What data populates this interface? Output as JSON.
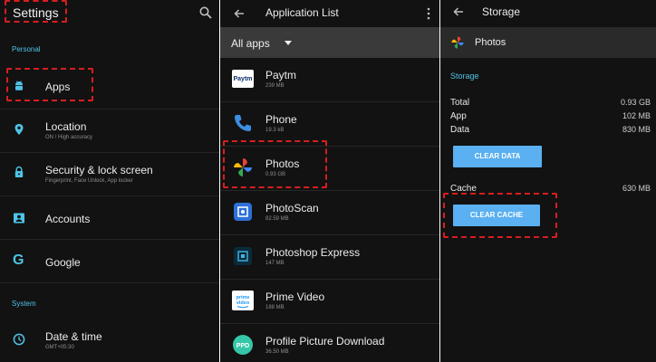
{
  "settings": {
    "title": "Settings",
    "search_icon": "search-icon",
    "section_personal": "Personal",
    "section_system": "System",
    "items": [
      {
        "label": "Apps",
        "sub": "",
        "icon": "android-icon"
      },
      {
        "label": "Location",
        "sub": "ON / High accuracy",
        "icon": "location-pin-icon"
      },
      {
        "label": "Security & lock screen",
        "sub": "Fingerprint, Face Unlock, App locker",
        "icon": "lock-icon"
      },
      {
        "label": "Accounts",
        "sub": "",
        "icon": "account-card-icon"
      },
      {
        "label": "Google",
        "sub": "",
        "icon": "google-g-icon"
      },
      {
        "label": "Date & time",
        "sub": "GMT+05:30",
        "icon": "clock-icon"
      }
    ]
  },
  "app_list": {
    "title": "Application List",
    "filter": "All apps",
    "apps": [
      {
        "name": "Paytm",
        "size": "239 MB",
        "icon": "paytm-icon"
      },
      {
        "name": "Phone",
        "size": "19.3 kB",
        "icon": "phone-icon"
      },
      {
        "name": "Photos",
        "size": "0.93 GB",
        "icon": "google-photos-icon"
      },
      {
        "name": "PhotoScan",
        "size": "82.59 MB",
        "icon": "photoscan-icon"
      },
      {
        "name": "Photoshop Express",
        "size": "147 MB",
        "icon": "photoshop-express-icon"
      },
      {
        "name": "Prime Video",
        "size": "188 MB",
        "icon": "prime-video-icon"
      },
      {
        "name": "Profile Picture Download",
        "size": "36.50 MB",
        "icon": "profile-picture-icon"
      }
    ]
  },
  "storage": {
    "title": "Storage",
    "app_name": "Photos",
    "section": "Storage",
    "stats": [
      {
        "label": "Total",
        "value": "0.93 GB"
      },
      {
        "label": "App",
        "value": "102 MB"
      },
      {
        "label": "Data",
        "value": "830 MB"
      }
    ],
    "clear_data_label": "CLEAR DATA",
    "cache_label": "Cache",
    "cache_value": "630 MB",
    "clear_cache_label": "CLEAR CACHE"
  },
  "colors": {
    "background": "#121212",
    "accent": "#4fc3e6",
    "button": "#5ab0f0",
    "highlight": "#d81e1e"
  }
}
